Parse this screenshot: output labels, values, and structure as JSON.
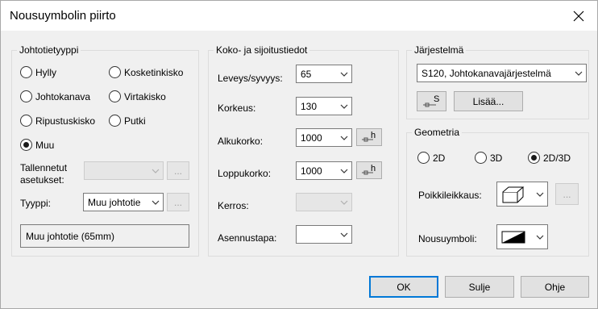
{
  "window": {
    "title": "Nousuymbolin piirto"
  },
  "johtotietyyppi": {
    "title": "Johtotietyyppi",
    "radios": [
      {
        "label": "Hylly",
        "checked": false
      },
      {
        "label": "Kosketinkisko",
        "checked": false
      },
      {
        "label": "Johtokanava",
        "checked": false
      },
      {
        "label": "Virtakisko",
        "checked": false
      },
      {
        "label": "Ripustuskisko",
        "checked": false
      },
      {
        "label": "Putki",
        "checked": false
      },
      {
        "label": "Muu",
        "checked": true
      }
    ],
    "tallennetut_label_1": "Tallennetut",
    "tallennetut_label_2": "asetukset:",
    "tallennetut_value": "",
    "tyyppi_label": "Tyyppi:",
    "tyyppi_value": "Muu johtotie",
    "ellipsis": "...",
    "summary": "Muu johtotie (65mm)"
  },
  "koko": {
    "title": "Koko- ja sijoitustiedot",
    "leveys_label": "Leveys/syvyys:",
    "leveys_value": "65",
    "korkeus_label": "Korkeus:",
    "korkeus_value": "130",
    "alkukorko_label": "Alkukorko:",
    "alkukorko_value": "1000",
    "loppukorko_label": "Loppukorko:",
    "loppukorko_value": "1000",
    "kerros_label": "Kerros:",
    "kerros_value": "",
    "asennustapa_label": "Asennustapa:",
    "asennustapa_value": "",
    "pick_glyph": "h"
  },
  "jarjestelma": {
    "title": "Järjestelmä",
    "value": "S120, Johtokanavajärjestelmä",
    "select_glyph": "S",
    "lisaa_label": "Lisää..."
  },
  "geometria": {
    "title": "Geometria",
    "radios": [
      {
        "label": "2D",
        "checked": false
      },
      {
        "label": "3D",
        "checked": false
      },
      {
        "label": "2D/3D",
        "checked": true
      }
    ],
    "poikki_label": "Poikkileikkaus:",
    "nousu_label": "Nousuymboli:",
    "ellipsis": "..."
  },
  "footer": {
    "ok": "OK",
    "sulje": "Sulje",
    "ohje": "Ohje"
  },
  "colors": {
    "default_button_border": "#0078d7",
    "background": "#f0f0f0"
  }
}
